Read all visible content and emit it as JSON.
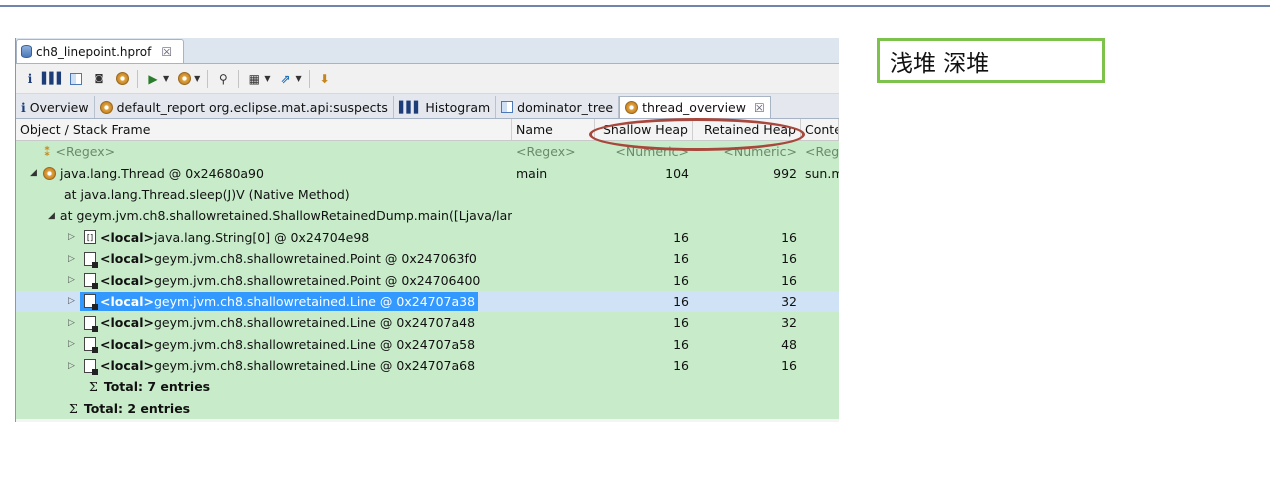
{
  "editor_tab": {
    "title": "ch8_linepoint.hprof",
    "close": "☒"
  },
  "toolbar": {
    "icons": [
      "info-icon",
      "histogram-icon",
      "dominator-tree-icon",
      "oql-icon",
      "thread-overview-icon",
      "run-report-icon",
      "query-browser-icon",
      "search-icon",
      "calculator-icon",
      "export-icon",
      "heap-dump-icon"
    ]
  },
  "view_tabs": [
    {
      "label": "Overview",
      "icon": "info-icon"
    },
    {
      "label": "default_report  org.eclipse.mat.api:suspects",
      "icon": "gear-icon"
    },
    {
      "label": "Histogram",
      "icon": "histogram-icon"
    },
    {
      "label": "dominator_tree",
      "icon": "dominator-tree-icon"
    },
    {
      "label": "thread_overview",
      "icon": "gear-icon",
      "close": "☒"
    }
  ],
  "table": {
    "columns": [
      "Object / Stack Frame",
      "Name",
      "Shallow Heap",
      "Retained Heap",
      "Conte"
    ],
    "regex_row": {
      "obj": "<Regex>",
      "name": "<Regex>",
      "shallow": "<Numeric>",
      "retained": "<Numeric>",
      "ctx": "<Reg"
    },
    "rows": [
      {
        "obj": "java.lang.Thread @ 0x24680a90",
        "name": "main",
        "shallow": "104",
        "retained": "992",
        "ctx": "sun.m"
      },
      {
        "obj": "at java.lang.Thread.sleep(J)V (Native Method)",
        "name": "",
        "shallow": "",
        "retained": "",
        "ctx": ""
      },
      {
        "obj": "at geym.jvm.ch8.shallowretained.ShallowRetainedDump.main([Ljava/lang",
        "name": "",
        "shallow": "",
        "retained": "",
        "ctx": ""
      },
      {
        "local": "<local>",
        "obj": " java.lang.String[0] @ 0x24704e98",
        "shallow": "16",
        "retained": "16"
      },
      {
        "local": "<local>",
        "obj": " geym.jvm.ch8.shallowretained.Point @ 0x247063f0",
        "shallow": "16",
        "retained": "16"
      },
      {
        "local": "<local>",
        "obj": " geym.jvm.ch8.shallowretained.Point @ 0x24706400",
        "shallow": "16",
        "retained": "16"
      },
      {
        "local": "<local>",
        "obj": " geym.jvm.ch8.shallowretained.Line @ 0x24707a38",
        "shallow": "16",
        "retained": "32"
      },
      {
        "local": "<local>",
        "obj": " geym.jvm.ch8.shallowretained.Line @ 0x24707a48",
        "shallow": "16",
        "retained": "32"
      },
      {
        "local": "<local>",
        "obj": " geym.jvm.ch8.shallowretained.Line @ 0x24707a58",
        "shallow": "16",
        "retained": "48"
      },
      {
        "local": "<local>",
        "obj": " geym.jvm.ch8.shallowretained.Line @ 0x24707a68",
        "shallow": "16",
        "retained": "16"
      }
    ],
    "total_inner": "Total: 7 entries",
    "total_outer": "Total: 2 entries",
    "sigma": "Σ"
  },
  "annotation": {
    "note": "浅堆 深堆"
  },
  "colors": {
    "row_bg": "#c8ebc9",
    "selected": "#3399ff",
    "ellipse": "#a8473c",
    "note_border": "#7cc24b"
  }
}
